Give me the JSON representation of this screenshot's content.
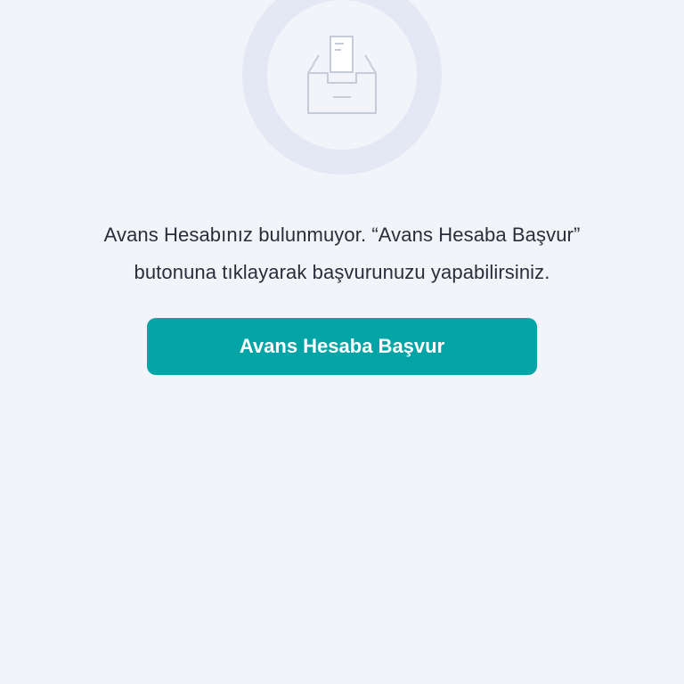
{
  "empty_state": {
    "icon": "inbox-tray-document-icon",
    "message_line1": "Avans Hesabınız bulunmuyor. “Avans Hesaba Başvur”",
    "message_line2": "butonuna tıklayarak başvurunuzu yapabilirsiniz.",
    "button_label": "Avans Hesaba Başvur"
  },
  "colors": {
    "background": "#f2f4fa",
    "ring": "#e3e8f4",
    "icon_stroke": "#c5cbd9",
    "text": "#2a2d3a",
    "button": "#02a4a6",
    "button_text": "#ffffff"
  }
}
